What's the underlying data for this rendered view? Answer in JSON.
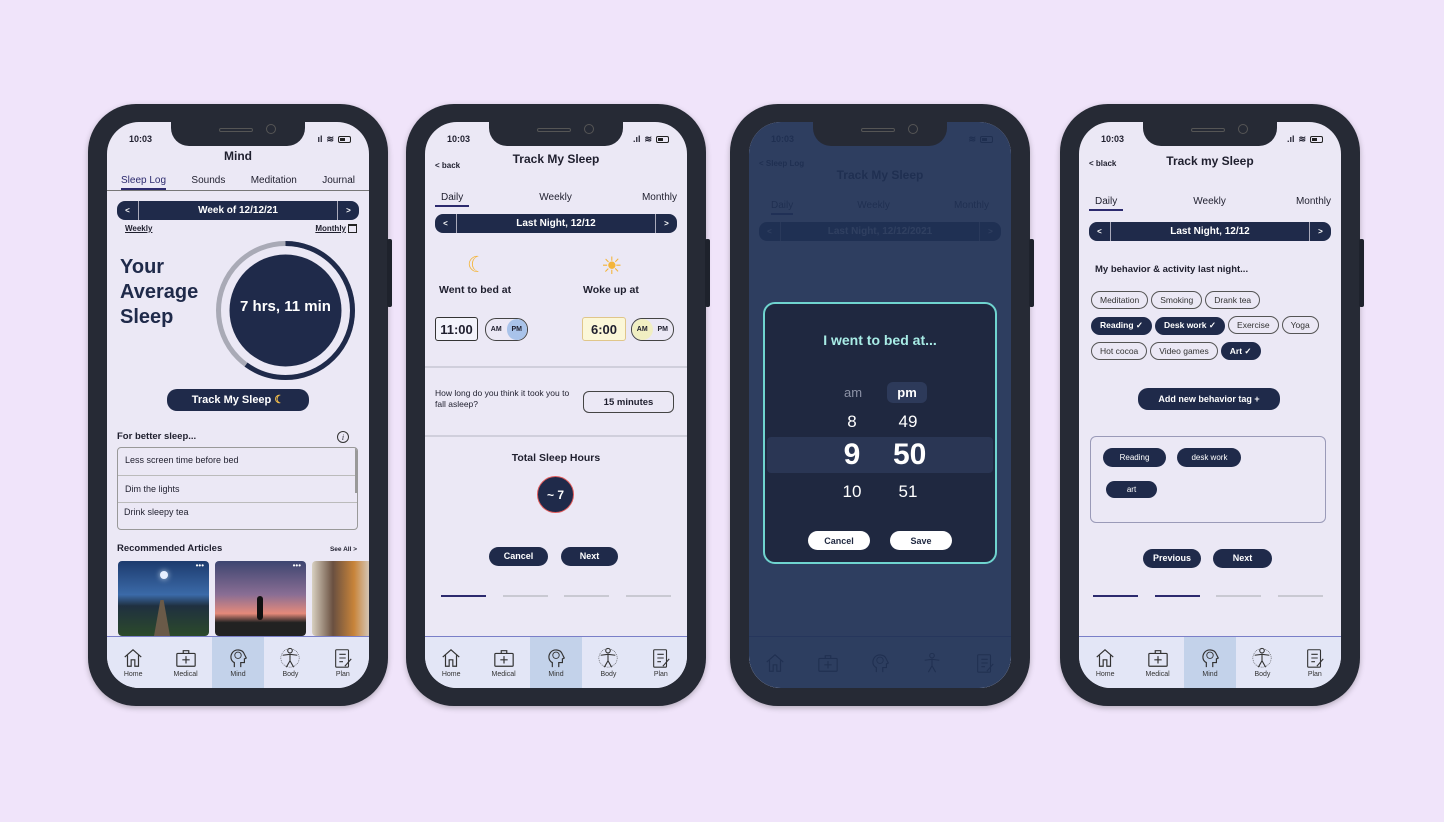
{
  "status_time": "10:03",
  "phone1": {
    "title": "Mind",
    "tabs": [
      "Sleep Log",
      "Sounds",
      "Meditation",
      "Journal"
    ],
    "week_label": "Week of 12/12/21",
    "prev": "<",
    "next": ">",
    "weekly": "Weekly",
    "monthly": "Monthly",
    "average_heading": [
      "Your",
      "Average",
      "Sleep"
    ],
    "average_value": "7 hrs, 11 min",
    "average_progress_fraction": 0.6,
    "track_button": "Track My Sleep",
    "tips_heading": "For better sleep...",
    "tips": [
      "Less screen time before bed",
      "Dim the lights",
      "Drink sleepy tea"
    ],
    "articles_heading": "Recommended Articles",
    "see_all": "See All >",
    "articles": [
      "moonlit-lake-dock",
      "yoga-sunset",
      "woman-meditating-at-laptop"
    ]
  },
  "phone2": {
    "back": "< back",
    "title": "Track My Sleep",
    "tabs": [
      "Daily",
      "Weekly",
      "Monthly"
    ],
    "date_label": "Last Night, 12/12",
    "bed_label": "Went to bed at",
    "bed_time": "11:00",
    "bed_ampm_selected": "PM",
    "wake_label": "Woke up at",
    "wake_time": "6:00",
    "wake_ampm_selected": "AM",
    "am": "AM",
    "pm": "PM",
    "fall_asleep_question": "How long do you think it took you to fall asleep?",
    "fall_asleep_value": "15 minutes",
    "total_label": "Total Sleep Hours",
    "total_value": "~ 7",
    "cancel": "Cancel",
    "next": "Next",
    "step": 1,
    "steps": 4
  },
  "phone3": {
    "back": "< Sleep Log",
    "title": "Track My Sleep",
    "tabs": [
      "Daily",
      "Weekly",
      "Monthly"
    ],
    "date_label": "Last Night, 12/12/2021",
    "modal_title": "I went to bed at...",
    "am": "am",
    "pm": "pm",
    "hours": [
      "8",
      "9",
      "10"
    ],
    "minutes": [
      "49",
      "50",
      "51"
    ],
    "cancel": "Cancel",
    "save": "Save"
  },
  "phone4": {
    "back": "< black",
    "title": "Track my Sleep",
    "tabs": [
      "Daily",
      "Weekly",
      "Monthly"
    ],
    "date_label": "Last Night, 12/12",
    "behavior_heading": "My behavior & activity last night...",
    "tag_rows": [
      [
        {
          "label": "Meditation",
          "on": false
        },
        {
          "label": "Smoking",
          "on": false
        },
        {
          "label": "Drank tea",
          "on": false
        }
      ],
      [
        {
          "label": "Reading ✓",
          "on": true
        },
        {
          "label": "Desk work ✓",
          "on": true
        },
        {
          "label": "Exercise",
          "on": false
        },
        {
          "label": "Yoga",
          "on": false
        }
      ],
      [
        {
          "label": "Hot cocoa",
          "on": false
        },
        {
          "label": "Video games",
          "on": false
        },
        {
          "label": "Art ✓",
          "on": true
        }
      ]
    ],
    "add_tag": "Add new behavior tag +",
    "selected_tags": [
      "Reading",
      "desk work",
      "art"
    ],
    "previous": "Previous",
    "next": "Next",
    "step": 2,
    "steps": 4
  },
  "nav": [
    "Home",
    "Medical",
    "Mind",
    "Body",
    "Plan"
  ],
  "nav_active": "Mind"
}
